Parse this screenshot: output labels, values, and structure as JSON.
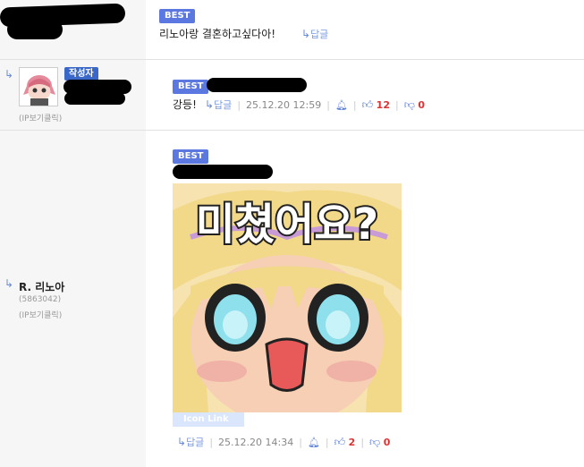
{
  "comment1": {
    "best": "BEST",
    "text": "리노아랑 결혼하고싶다아!",
    "reply": "답글"
  },
  "comment2": {
    "author_badge": "작성자",
    "ip_link": "(IP보기클릭)",
    "best": "BEST",
    "text": "강등!",
    "reply": "답글",
    "date": "25.12.20 12:59",
    "upvotes": "12",
    "downvotes": "0"
  },
  "comment3": {
    "nickname": "R. 리노아",
    "user_code": "(5863042)",
    "ip_link": "(IP보기클릭)",
    "best": "BEST",
    "sticker_text": "미쳤어요?",
    "icon_link": "Icon Link",
    "reply": "답글",
    "date": "25.12.20 14:34",
    "upvotes": "2",
    "downvotes": "0"
  },
  "colors": {
    "best_badge": "#5b78e0",
    "vote_count": "#dd3333",
    "link_blue": "#7a9be0"
  }
}
